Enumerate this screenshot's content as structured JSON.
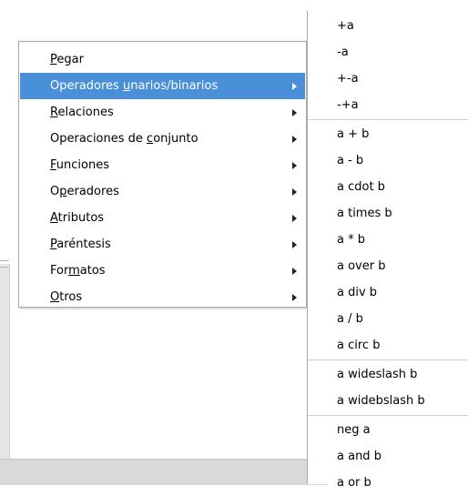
{
  "context_menu": {
    "items": [
      {
        "pre": "",
        "acc": "P",
        "post": "egar",
        "submenu": false,
        "highlighted": false
      },
      {
        "pre": "Operadores ",
        "acc": "u",
        "post": "narios/binarios",
        "submenu": true,
        "highlighted": true
      },
      {
        "pre": "",
        "acc": "R",
        "post": "elaciones",
        "submenu": true,
        "highlighted": false
      },
      {
        "pre": "Operaciones de ",
        "acc": "c",
        "post": "onjunto",
        "submenu": true,
        "highlighted": false
      },
      {
        "pre": "",
        "acc": "F",
        "post": "unciones",
        "submenu": true,
        "highlighted": false
      },
      {
        "pre": "O",
        "acc": "p",
        "post": "eradores",
        "submenu": true,
        "highlighted": false
      },
      {
        "pre": "",
        "acc": "A",
        "post": "tributos",
        "submenu": true,
        "highlighted": false
      },
      {
        "pre": "",
        "acc": "P",
        "post": "aréntesis",
        "submenu": true,
        "highlighted": false
      },
      {
        "pre": "For",
        "acc": "m",
        "post": "atos",
        "submenu": true,
        "highlighted": false
      },
      {
        "pre": "",
        "acc": "O",
        "post": "tros",
        "submenu": true,
        "highlighted": false
      }
    ]
  },
  "submenu": {
    "groups": [
      [
        "+a",
        "-a",
        "+-a",
        "-+a"
      ],
      [
        "a + b",
        "a - b",
        "a cdot b",
        "a times b",
        "a * b",
        "a over b",
        "a div b",
        "a / b",
        "a circ b"
      ],
      [
        "a wideslash b",
        "a widebslash b"
      ],
      [
        "neg a",
        "a and b",
        "a or b"
      ]
    ]
  },
  "colors": {
    "highlight": "#4a90d9",
    "menu_border": "#aaaaaa",
    "separator": "#d0d0d0"
  }
}
